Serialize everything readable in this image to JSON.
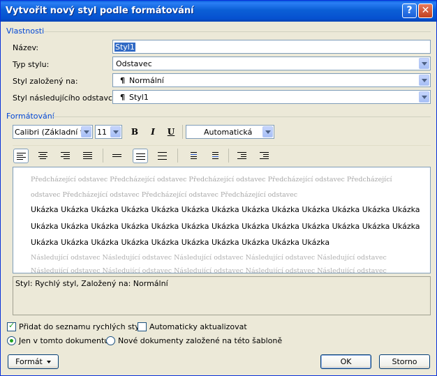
{
  "dialog": {
    "title": "Vytvořit nový styl podle formátování",
    "help_glyph": "?",
    "close_glyph": "✕"
  },
  "properties": {
    "group_label": "Vlastnosti",
    "name_label": "Název:",
    "name_value": "Styl1",
    "type_label": "Typ stylu:",
    "type_value": "Odstavec",
    "based_label": "Styl založený na:",
    "based_value": "Normální",
    "next_label": "Styl následujícího odstavce:",
    "next_value": "Styl1",
    "para_glyph": "¶"
  },
  "formatting": {
    "group_label": "Formátování",
    "font": "Calibri (Základní tex",
    "size": "11",
    "bold": "B",
    "italic": "I",
    "underline": "U",
    "color": "Automatická"
  },
  "preview": {
    "previous_line1": "Předcházející odstavec Předcházející odstavec Předcházející odstavec Předcházející odstavec Předcházející",
    "previous_line2": "odstavec Předcházející odstavec Předcházející odstavec Předcházející odstavec",
    "sample_line1": "Ukázka Ukázka Ukázka Ukázka Ukázka Ukázka Ukázka Ukázka Ukázka Ukázka Ukázka Ukázka Ukázka",
    "sample_line2": "Ukázka Ukázka Ukázka Ukázka Ukázka Ukázka Ukázka Ukázka Ukázka Ukázka Ukázka Ukázka Ukázka",
    "sample_line3": "Ukázka Ukázka Ukázka Ukázka Ukázka Ukázka Ukázka Ukázka Ukázka Ukázka",
    "next_line1": "Následující odstavec Následující odstavec Následující odstavec Následující odstavec Následující odstavec",
    "next_line2": "Následující odstavec Následující odstavec Následující odstavec Následující odstavec Následující odstavec"
  },
  "description": "Styl: Rychlý styl, Založený na: Normální",
  "options": {
    "add_quick_styles": "Přidat do seznamu rychlých stylů",
    "add_quick_styles_checked": true,
    "auto_update": "Automaticky aktualizovat",
    "auto_update_checked": false,
    "this_document": "Jen v tomto dokumentu",
    "new_documents": "Nové dokumenty založené na této šabloně",
    "selected_scope": "this_document"
  },
  "buttons": {
    "format": "Formát",
    "ok": "OK",
    "cancel": "Storno"
  },
  "colors": {
    "titlebar": "#0a5fe0",
    "group_label": "#0046d5",
    "dialog_bg": "#ece9d8",
    "checkmark": "#21a121"
  }
}
